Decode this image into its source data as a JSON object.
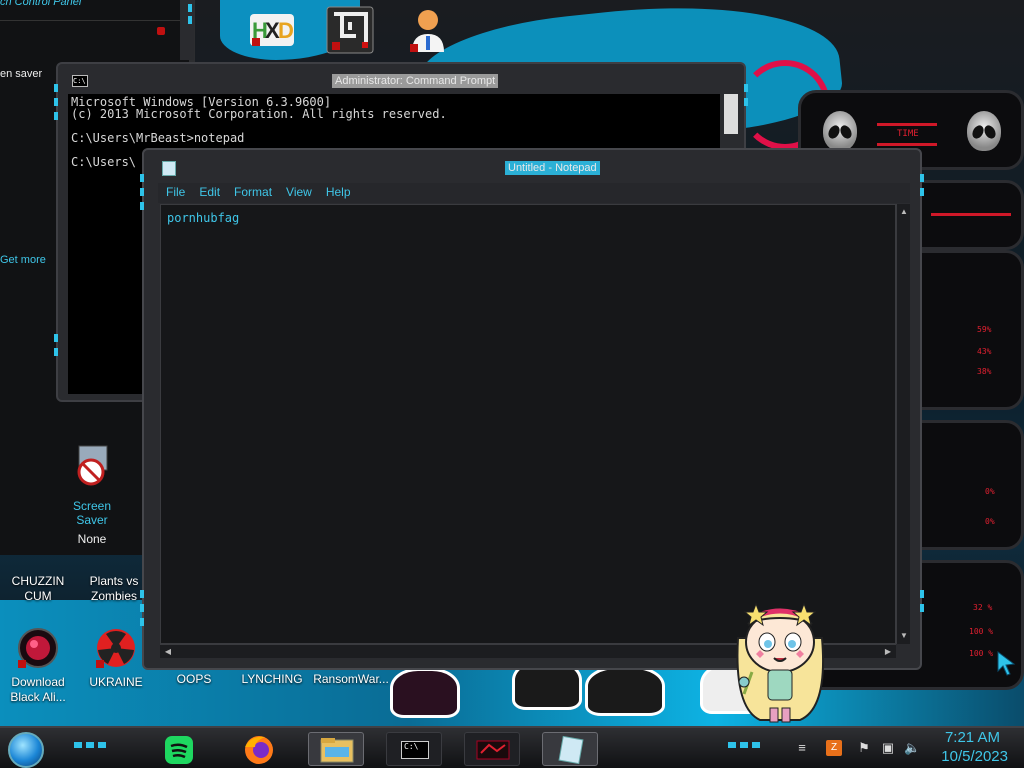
{
  "control_panel": {
    "title": "ch Control Panel",
    "screen_saver_text": "en saver",
    "get_more_link": "Get more",
    "screen_saver_label": "Screen Saver",
    "screen_saver_value": "None"
  },
  "cmd": {
    "title": "Administrator: Command Prompt",
    "icon_text": "C:\\",
    "lines": [
      "Microsoft Windows [Version 6.3.9600]",
      "(c) 2013 Microsoft Corporation. All rights reserved.",
      "",
      "C:\\Users\\MrBeast>notepad",
      "",
      "C:\\Users\\"
    ]
  },
  "notepad": {
    "title": "Untitled - Notepad",
    "menu": [
      "File",
      "Edit",
      "Format",
      "View",
      "Help"
    ],
    "content": "pornhubfag"
  },
  "desktop_icons": [
    {
      "label": "CHUZZIN CUM"
    },
    {
      "label": "Plants vs Zombies"
    },
    {
      "label": "Download Black Ali..."
    },
    {
      "label": "UKRAINE"
    },
    {
      "label": "OOPS"
    },
    {
      "label": "LYNCHING"
    },
    {
      "label": "RansomWar..."
    }
  ],
  "gadgets": {
    "top_label": "TIME",
    "percent_values": [
      "59%",
      "43%",
      "38%"
    ],
    "disk_values": [
      "0%",
      "0%"
    ],
    "net_values": [
      "32 %",
      "100 %",
      "100 %"
    ]
  },
  "taskbar": {
    "time": "7:21 AM",
    "date": "10/5/2023"
  },
  "colors": {
    "accent": "#3fc6e8",
    "red": "#e02030"
  }
}
